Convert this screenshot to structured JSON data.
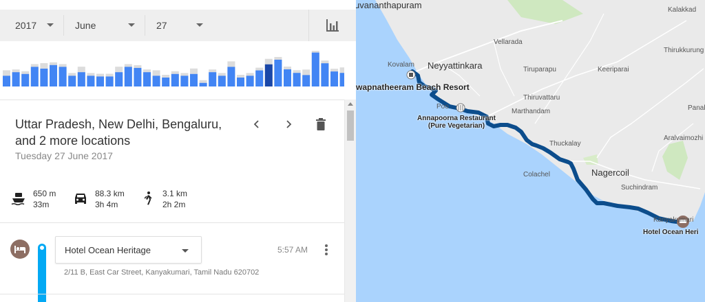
{
  "date_picker": {
    "year": "2017",
    "month": "June",
    "day": "27"
  },
  "stats_button_icon": "bar-chart-icon",
  "histogram": {
    "bars": [
      0.3,
      0.4,
      0.35,
      0.55,
      0.5,
      0.6,
      0.55,
      0.3,
      0.4,
      0.3,
      0.28,
      0.28,
      0.4,
      0.55,
      0.52,
      0.4,
      0.3,
      0.25,
      0.35,
      0.3,
      0.35,
      0.1,
      0.4,
      0.3,
      0.55,
      0.25,
      0.3,
      0.45,
      0.62,
      0.75,
      0.48,
      0.38,
      0.32,
      0.95,
      0.65,
      0.42,
      0.38,
      0.43,
      0.38,
      0.05
    ],
    "selected_index": 28,
    "colors": {
      "normal": "#4285f4",
      "faded": "#9dbdf6",
      "selected": "#1a47a8",
      "shadow": "#dcdcdc"
    }
  },
  "summary": {
    "title": "Uttar Pradesh, New Delhi, Bengaluru, and 2 more locations",
    "date": "Tuesday 27 June 2017",
    "prev_icon": "chevron-left-icon",
    "next_icon": "chevron-right-icon",
    "delete_icon": "trash-icon"
  },
  "modes": [
    {
      "icon": "ferry-icon",
      "distance": "650 m",
      "duration": "33m"
    },
    {
      "icon": "car-icon",
      "distance": "88.3 km",
      "duration": "3h 4m"
    },
    {
      "icon": "walk-icon",
      "distance": "3.1 km",
      "duration": "2h 2m"
    }
  ],
  "timeline": {
    "place_icon": "hotel-icon",
    "place_name": "Hotel Ocean Heritage",
    "time": "5:57 AM",
    "address": "2/11 B, East Car Street, Kanyakumari, Tamil Nadu 620702",
    "menu_icon": "more-vert-icon",
    "accent": "#03a9f4"
  },
  "map": {
    "labels": {
      "thiruvananthapuram": "uvananthapuram",
      "kalakkad": "Kalakkad",
      "vellarada": "Vellarada",
      "thirukkurungudi": "Thirukkurung",
      "kovalam": "Kovalam",
      "neyyattinkara": "Neyyattinkara",
      "tiruparapu": "Tiruparapu",
      "keeriparai": "Keeriparai",
      "beach_resort": "wapnatheeram Beach Resort",
      "thiruvattaru": "Thiruvattaru",
      "panakudi": "Panakud",
      "poovar": "Poo",
      "marthandam": "Marthandam",
      "restaurant": "Annapoorna Restaurant (Pure Vegetarian)",
      "aralvaimozhi": "Aralvaimozhi",
      "thuckalay": "Thuckalay",
      "colachel": "Colachel",
      "nagercoil": "Nagercoil",
      "suchindram": "Suchindram",
      "kanyakumari": "Kanyakumari",
      "hotel": "Hotel Ocean Heri"
    },
    "colors": {
      "sea": "#aad3fd",
      "land": "#eaeaea",
      "route": "#0c4d8c"
    }
  }
}
